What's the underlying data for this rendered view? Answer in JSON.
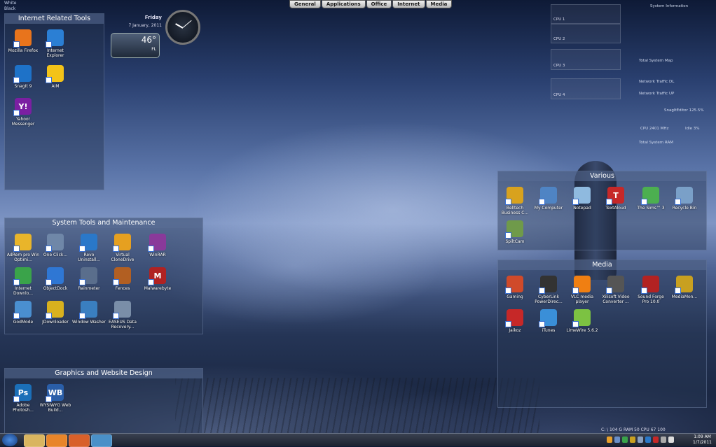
{
  "topleft": {
    "line1": "White",
    "line2": "Black"
  },
  "tabs": [
    "General",
    "Applications",
    "Office",
    "Internet",
    "Media"
  ],
  "weather": {
    "day": "Friday",
    "date": "7 January, 2011",
    "temp": "46°",
    "loc": "FL"
  },
  "fences": {
    "internet": {
      "title": "Internet Related Tools",
      "icons": [
        {
          "label": "Mozilla Firefox",
          "color": "#e8741c"
        },
        {
          "label": "Internet Explorer",
          "color": "#2b7fd4"
        },
        {
          "label": "SnagIt 9",
          "color": "#1e72c8"
        },
        {
          "label": "AIM",
          "color": "#f3c318"
        },
        {
          "label": "Yahoo! Messenger",
          "color": "#7b1fa2"
        }
      ]
    },
    "system": {
      "title": "System Tools and Maintenance",
      "icons": [
        {
          "label": "AdRem pro Win Optimi...",
          "color": "#e9b52a"
        },
        {
          "label": "One Click...",
          "color": "#6f87a8"
        },
        {
          "label": "Revo Uninstall...",
          "color": "#2a78c9"
        },
        {
          "label": "Virtual CloneDrive",
          "color": "#e6a020"
        },
        {
          "label": "WinRAR",
          "color": "#8a3a9a"
        },
        {
          "label": "Internet Downlo...",
          "color": "#3aa34a"
        },
        {
          "label": "ObjectDock",
          "color": "#2f77d4"
        },
        {
          "label": "Rainmeter",
          "color": "#5a6e8c"
        },
        {
          "label": "Fences",
          "color": "#b25f22"
        },
        {
          "label": "Malwarebyte",
          "color": "#b02222"
        },
        {
          "label": "GodMode",
          "color": "#4a8fd0"
        },
        {
          "label": "JDownloader",
          "color": "#d8b11e"
        },
        {
          "label": "Window Washer",
          "color": "#3a7fc0"
        },
        {
          "label": "EASEUS Data Recovery...",
          "color": "#7a8ea8"
        }
      ]
    },
    "graphics": {
      "title": "Graphics and Website Design",
      "icons": [
        {
          "label": "Adobe Photosh...",
          "color": "#1b6fb8"
        },
        {
          "label": "WYSIWYG Web Build...",
          "color": "#2a5ea8"
        }
      ]
    },
    "various": {
      "title": "Various",
      "icons": [
        {
          "label": "Belltech Business C...",
          "color": "#d8a21e"
        },
        {
          "label": "My Computer",
          "color": "#4f84c4"
        },
        {
          "label": "Notepad",
          "color": "#8fbadf"
        },
        {
          "label": "TextAloud",
          "color": "#c62828"
        },
        {
          "label": "The Sims™ 3",
          "color": "#4caf50"
        },
        {
          "label": "Recycle Bin",
          "color": "#7aa0c8"
        },
        {
          "label": "SpiltCam",
          "color": "#6f9a4a"
        }
      ]
    },
    "media": {
      "title": "Media",
      "icons": [
        {
          "label": "Gaming",
          "color": "#d04a2a"
        },
        {
          "label": "CyberLink PowerDirec...",
          "color": "#333333"
        },
        {
          "label": "VLC media player",
          "color": "#f07f12"
        },
        {
          "label": "Xilisoft Video Converter ...",
          "color": "#555555"
        },
        {
          "label": "Sound Forge Pro 10.0",
          "color": "#b22222"
        },
        {
          "label": "MediaMon...",
          "color": "#c8a020"
        },
        {
          "label": "Jaikoz",
          "color": "#c62828"
        },
        {
          "label": "iTunes",
          "color": "#3a8fd8"
        },
        {
          "label": "LimeWire 5.6.2",
          "color": "#7cc242"
        }
      ]
    }
  },
  "sysinfo": {
    "title": "System Information",
    "cpu1": "CPU 1",
    "cpu2": "CPU 2",
    "cpu3": "CPU 3",
    "cpu4": "CPU 4",
    "mem": "Total System Map",
    "net_dl": "Network Traffic DL",
    "net_ul": "Network Traffic UP",
    "snag": "SnagItEditor 125.5%",
    "cpu_mhz": "CPU 2401 MHz",
    "idle": "Idle 3%",
    "ram": "Total System RAM"
  },
  "bottom_info": "C: \\ 104 G  RAM 50  CPU 67  100",
  "taskbar": {
    "time": "1:09 AM",
    "date": "1/7/2011"
  }
}
